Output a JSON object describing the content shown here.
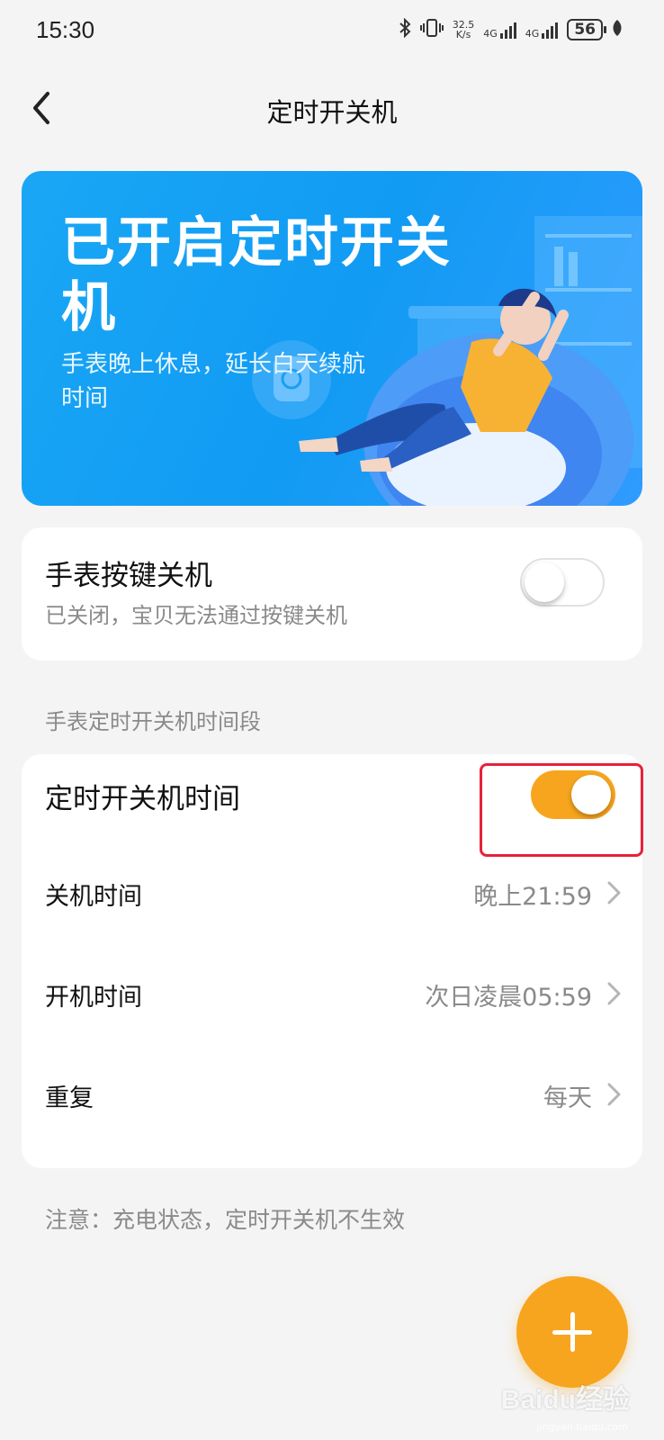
{
  "status_bar": {
    "time": "15:30",
    "net_speed": "32.5\nK/s",
    "net1": "4G",
    "net2": "4G",
    "battery": "56"
  },
  "header": {
    "title": "定时开关机"
  },
  "banner": {
    "title": "已开启定时开关机",
    "subtitle": "手表晚上休息，延长白天续航时间"
  },
  "key_shutdown": {
    "title": "手表按键关机",
    "subtitle": "已关闭，宝贝无法通过按键关机",
    "enabled": false
  },
  "section_label": "手表定时开关机时间段",
  "schedule": {
    "toggle_label": "定时开关机时间",
    "enabled": true,
    "rows": [
      {
        "label": "关机时间",
        "value": "晚上21:59"
      },
      {
        "label": "开机时间",
        "value": "次日凌晨05:59"
      },
      {
        "label": "重复",
        "value": "每天"
      }
    ]
  },
  "note": "注意：充电状态，定时开关机不生效",
  "watermark": {
    "text": "Baidu经验",
    "sub": "jingyan.baidu.com"
  },
  "colors": {
    "accent": "#f7a51e",
    "banner": "#1aa7f5",
    "highlight": "#e8213a"
  }
}
